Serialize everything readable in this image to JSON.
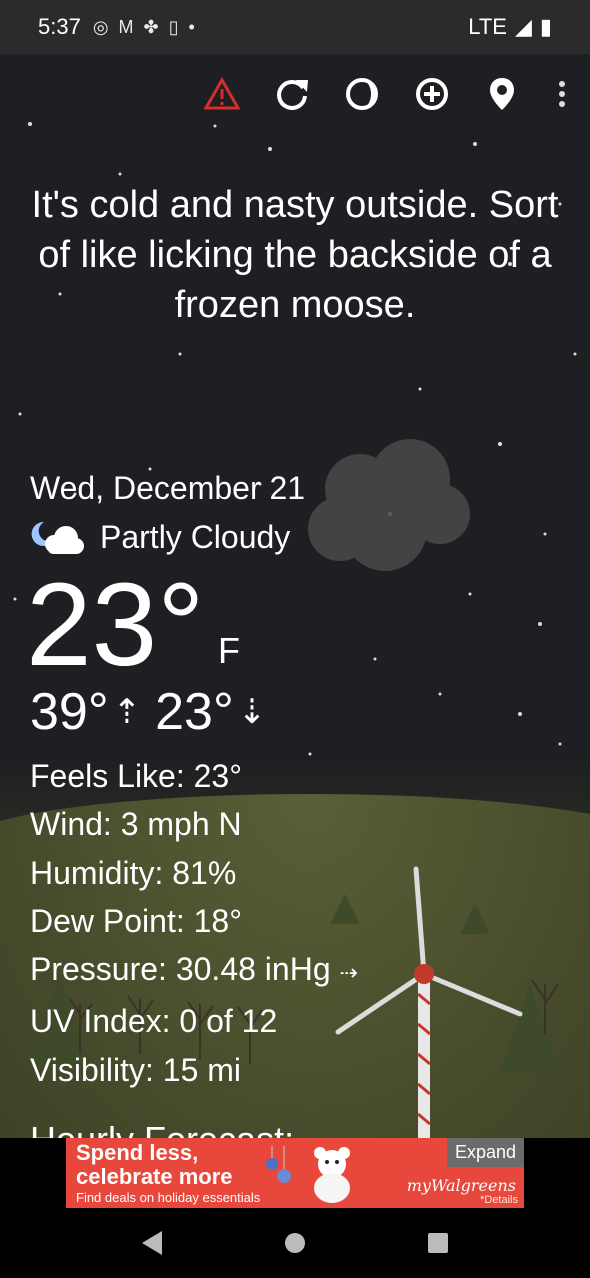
{
  "status_bar": {
    "time": "5:37",
    "network": "LTE"
  },
  "quote": "It's cold and nasty outside. Sort of like licking the backside of a frozen moose.",
  "weather": {
    "date": "Wed, December 21",
    "condition": "Partly Cloudy",
    "temperature": "23°",
    "unit": "F",
    "high": "39°",
    "low": "23°"
  },
  "details": {
    "feels_like": "Feels Like:  23°",
    "wind": "Wind:  3 mph N",
    "humidity": "Humidity:  81%",
    "dew_point": "Dew Point:  18°",
    "pressure": "Pressure:  30.48 inHg",
    "uv_index": "UV Index:  0 of 12",
    "visibility": "Visibility:  15 mi"
  },
  "hourly_heading": "Hourly Forecast:",
  "ad": {
    "line1": "Spend less,",
    "line2": "celebrate more",
    "line3": "Find deals on holiday essentials",
    "expand": "Expand",
    "brand": "myWalgreens",
    "details": "*Details"
  },
  "colors": {
    "alert": "#d32f2f",
    "ad_background": "#e8473b"
  }
}
